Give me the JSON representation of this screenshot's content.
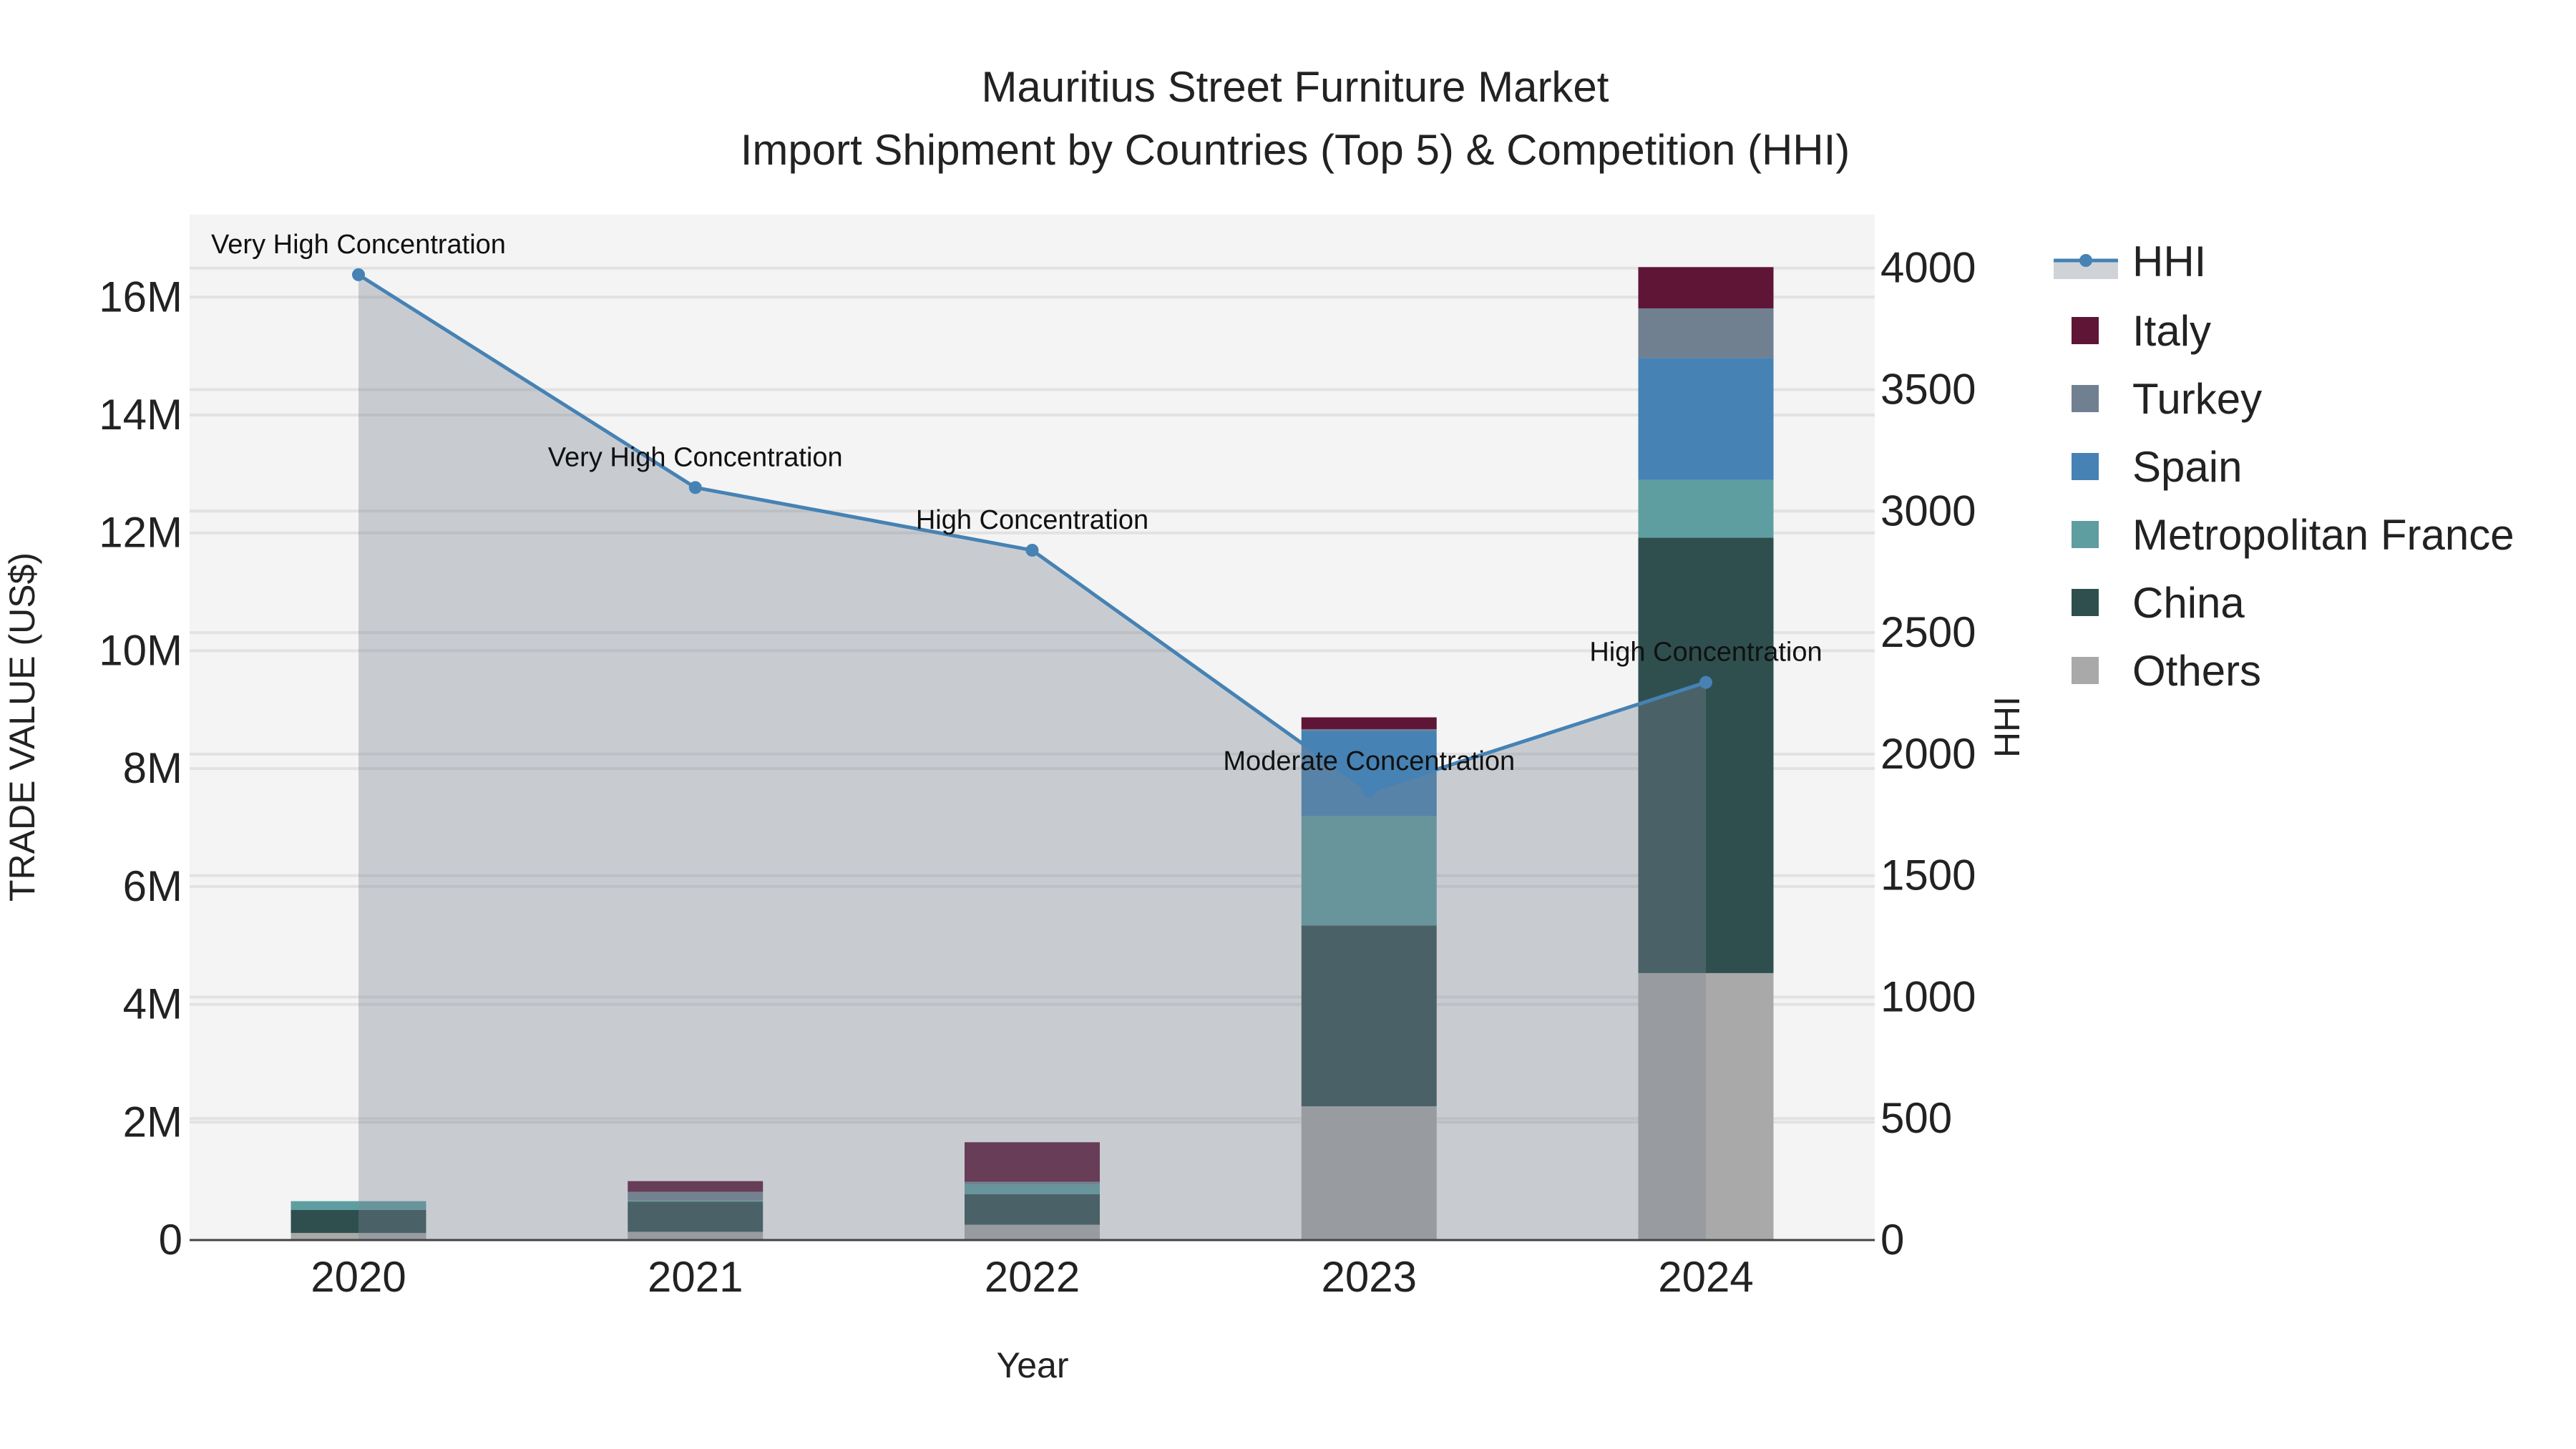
{
  "chart_data": {
    "type": "bar",
    "title": "Mauritius Street Furniture Market",
    "subtitle": "Import Shipment by Countries (Top 5) & Competition (HHI)",
    "xlabel": "Year",
    "ylabel": "TRADE VALUE (US$)",
    "y2label": "HHI",
    "categories": [
      "2020",
      "2021",
      "2022",
      "2023",
      "2024"
    ],
    "ylim": [
      0,
      17400000
    ],
    "y2lim": [
      0,
      4220
    ],
    "yticks": [
      0,
      2000000,
      4000000,
      6000000,
      8000000,
      10000000,
      12000000,
      14000000,
      16000000
    ],
    "ytick_labels": [
      "0",
      "2M",
      "4M",
      "6M",
      "8M",
      "10M",
      "12M",
      "14M",
      "16M"
    ],
    "y2ticks": [
      0,
      500,
      1000,
      1500,
      2000,
      2500,
      3000,
      3500,
      4000
    ],
    "y2tick_labels": [
      "0",
      "500",
      "1000",
      "1500",
      "2000",
      "2500",
      "3000",
      "3500",
      "4000"
    ],
    "grid": true,
    "legend_position": "right",
    "series": [
      {
        "name": "Others",
        "color": "#a9a9a9",
        "values": [
          120000,
          140000,
          260000,
          2270000,
          4530000
        ]
      },
      {
        "name": "China",
        "color": "#2f4f4f",
        "values": [
          390000,
          510000,
          520000,
          3070000,
          7390000
        ]
      },
      {
        "name": "Metropolitan France",
        "color": "#5f9ea0",
        "values": [
          150000,
          20000,
          160000,
          1850000,
          980000
        ]
      },
      {
        "name": "Spain",
        "color": "#4682b4",
        "values": [
          0,
          0,
          0,
          1450000,
          2070000
        ]
      },
      {
        "name": "Turkey",
        "color": "#708090",
        "values": [
          0,
          150000,
          50000,
          30000,
          840000
        ]
      },
      {
        "name": "Italy",
        "color": "#5f1536",
        "values": [
          0,
          180000,
          670000,
          200000,
          700000
        ]
      }
    ],
    "hhi": {
      "name": "HHI",
      "color": "#4682b4",
      "values": [
        3973,
        3097,
        2839,
        1847,
        2295
      ],
      "annotations": [
        "Very High Concentration",
        "Very High Concentration",
        "High Concentration",
        "Moderate Concentration",
        "High Concentration"
      ]
    },
    "legend_order": [
      "HHI",
      "Italy",
      "Turkey",
      "Spain",
      "Metropolitan France",
      "China",
      "Others"
    ]
  }
}
